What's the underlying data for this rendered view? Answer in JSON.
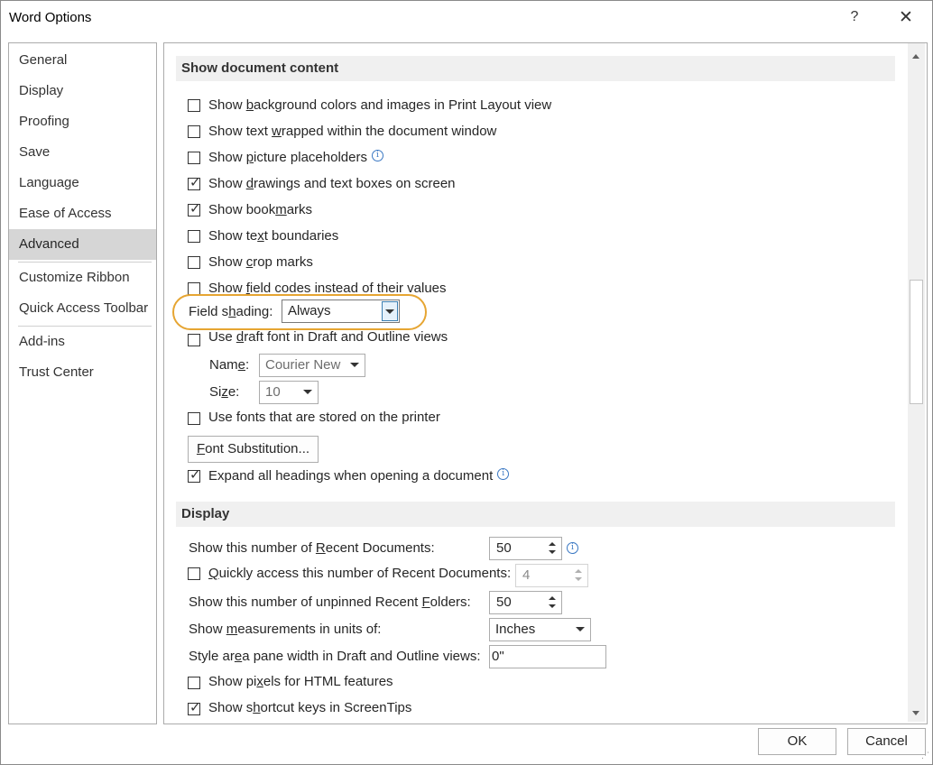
{
  "window": {
    "title": "Word Options",
    "help_glyph": "?",
    "close_glyph": "✕"
  },
  "nav": {
    "items": [
      {
        "label": "General",
        "selected": false
      },
      {
        "label": "Display",
        "selected": false
      },
      {
        "label": "Proofing",
        "selected": false
      },
      {
        "label": "Save",
        "selected": false
      },
      {
        "label": "Language",
        "selected": false
      },
      {
        "label": "Ease of Access",
        "selected": false
      },
      {
        "label": "Advanced",
        "selected": true
      },
      {
        "label": "Customize Ribbon",
        "selected": false
      },
      {
        "label": "Quick Access Toolbar",
        "selected": false
      },
      {
        "label": "Add-ins",
        "selected": false
      },
      {
        "label": "Trust Center",
        "selected": false
      }
    ]
  },
  "show_document_content": {
    "header": "Show document content",
    "options": [
      {
        "pre": "Show ",
        "u": "b",
        "post": "ackground colors and images in Print Layout view",
        "checked": false,
        "info": false
      },
      {
        "pre": "Show text ",
        "u": "w",
        "post": "rapped within the document window",
        "checked": false,
        "info": false
      },
      {
        "pre": "Show ",
        "u": "p",
        "post": "icture placeholders",
        "checked": false,
        "info": true
      },
      {
        "pre": "Show ",
        "u": "d",
        "post": "rawings and text boxes on screen",
        "checked": true,
        "info": false
      },
      {
        "pre": "Show book",
        "u": "m",
        "post": "arks",
        "checked": true,
        "info": false
      },
      {
        "pre": "Show te",
        "u": "x",
        "post": "t boundaries",
        "checked": false,
        "info": false
      },
      {
        "pre": "Show ",
        "u": "c",
        "post": "rop marks",
        "checked": false,
        "info": false
      },
      {
        "pre": "Show ",
        "u": "f",
        "post": "ield codes instead of their values",
        "checked": false,
        "info": false
      }
    ],
    "field_shading": {
      "pre": "Field s",
      "u": "h",
      "post": "ading:",
      "value": "Always"
    },
    "draft_font": {
      "pre": "Use ",
      "u": "d",
      "post": "raft font in Draft and Outline views",
      "checked": false
    },
    "name": {
      "pre": "Nam",
      "u": "e",
      "post": ":",
      "value": "Courier New"
    },
    "size": {
      "pre": "Si",
      "u": "z",
      "post": "e:",
      "value": "10"
    },
    "printer_fonts": {
      "label": "Use fonts that are stored on the printer",
      "checked": false
    },
    "font_substitution": {
      "u": "F",
      "post": "ont Substitution..."
    },
    "expand_headings": {
      "label": "Expand all headings when opening a document",
      "checked": true
    }
  },
  "display": {
    "header": "Display",
    "recent_docs": {
      "pre": "Show this number of ",
      "u": "R",
      "post": "ecent Documents:",
      "value": "50"
    },
    "quick_access": {
      "pre": "",
      "u": "Q",
      "post": "uickly access this number of Recent Documents:",
      "value": "4",
      "checked": false
    },
    "unpinned_folders": {
      "pre": "Show this number of unpinned Recent ",
      "u": "F",
      "post": "olders:",
      "value": "50"
    },
    "measurements": {
      "pre": "Show ",
      "u": "m",
      "post": "easurements in units of:",
      "value": "Inches"
    },
    "style_area": {
      "pre": "Style ar",
      "u": "e",
      "post": "a pane width in Draft and Outline views:",
      "value": "0\""
    },
    "pixels": {
      "pre": "Show pi",
      "u": "x",
      "post": "els for HTML features",
      "checked": false
    },
    "shortcut_keys": {
      "pre": "Show s",
      "u": "h",
      "post": "ortcut keys in ScreenTips",
      "checked": true
    }
  },
  "footer": {
    "ok": "OK",
    "cancel": "Cancel"
  },
  "colors": {
    "highlight": "#e6a532",
    "selected_nav": "#d6d6d6",
    "info_icon": "#3a78c3"
  }
}
